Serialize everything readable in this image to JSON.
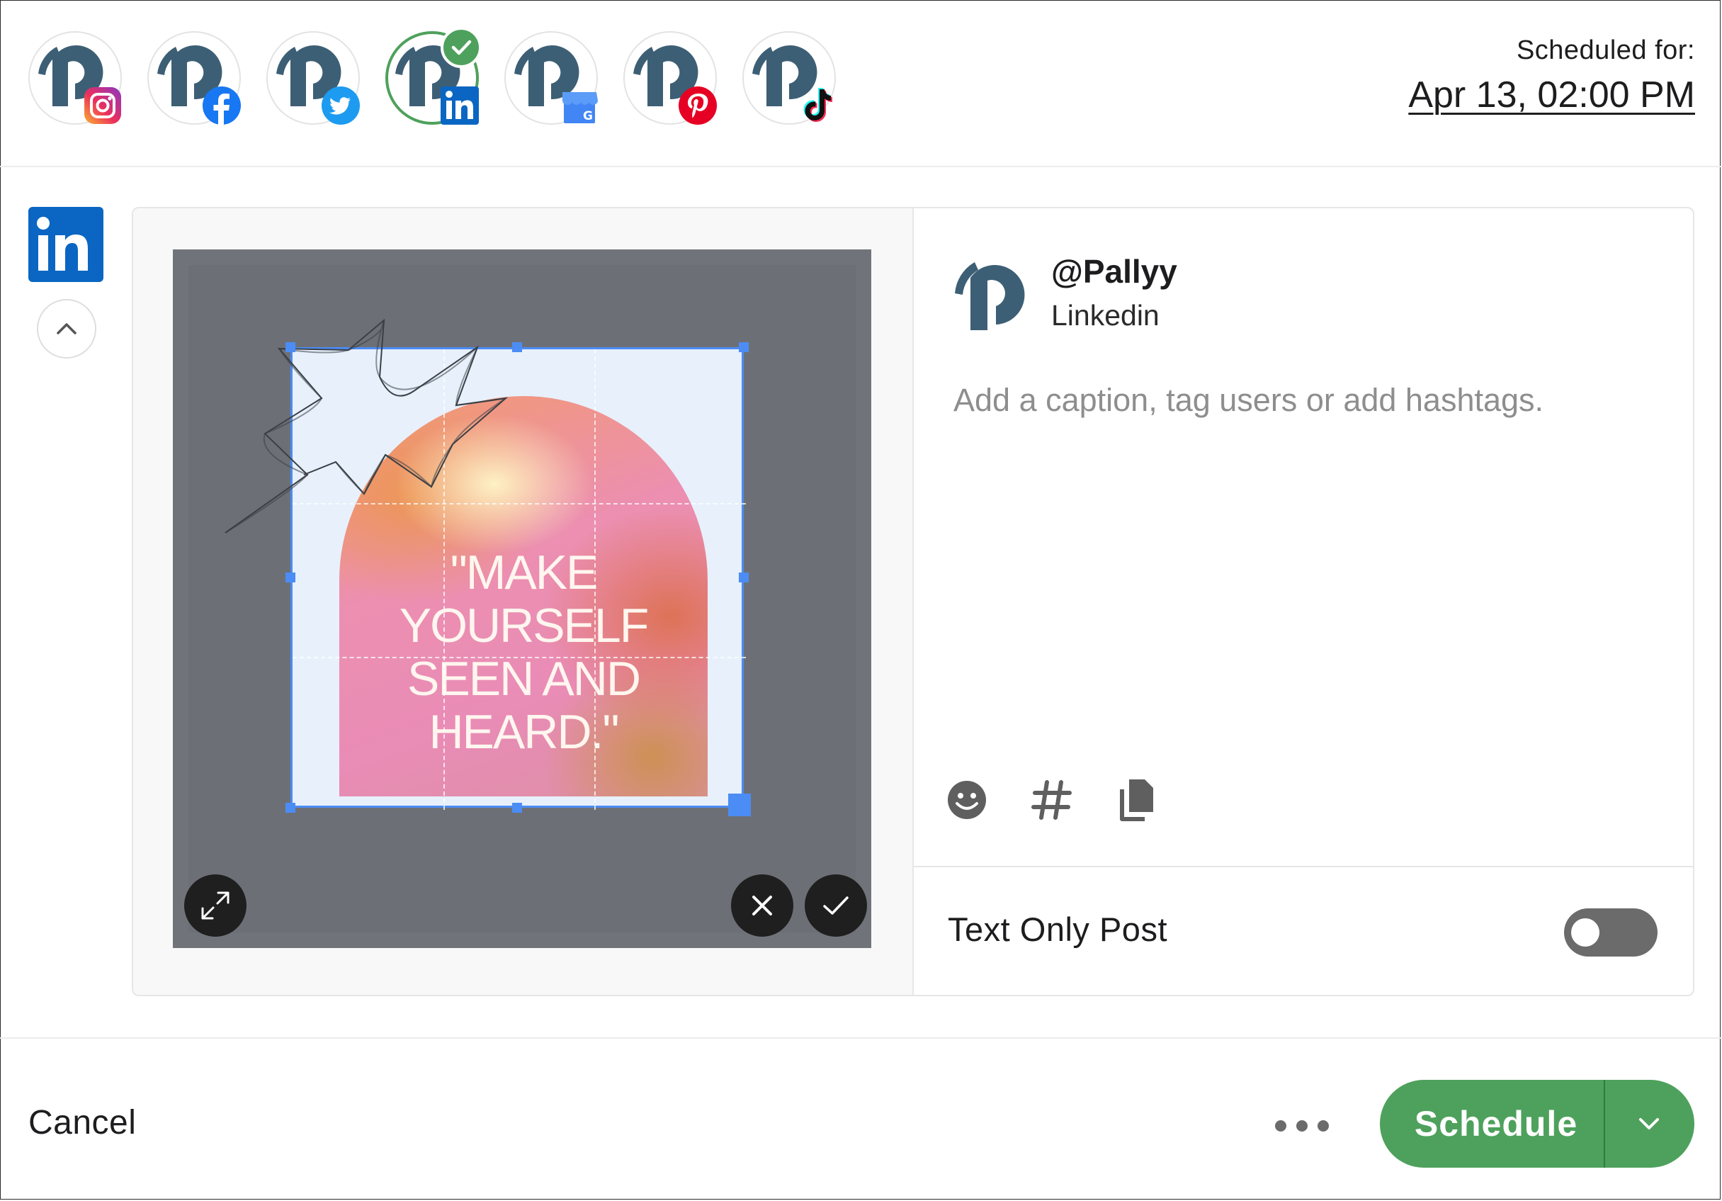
{
  "header": {
    "scheduled_label": "Scheduled for:",
    "scheduled_date": "Apr 13, 02:00 PM",
    "accounts": [
      {
        "network": "instagram",
        "badge_icon": "instagram-icon",
        "selected": false
      },
      {
        "network": "facebook",
        "badge_icon": "facebook-icon",
        "selected": false
      },
      {
        "network": "twitter",
        "badge_icon": "twitter-icon",
        "selected": false
      },
      {
        "network": "linkedin",
        "badge_icon": "linkedin-icon",
        "selected": true
      },
      {
        "network": "google-business",
        "badge_icon": "google-business-icon",
        "selected": false
      },
      {
        "network": "pinterest",
        "badge_icon": "pinterest-icon",
        "selected": false
      },
      {
        "network": "tiktok",
        "badge_icon": "tiktok-icon",
        "selected": false
      }
    ]
  },
  "sidebar": {
    "active_network_icon": "linkedin-icon",
    "collapse_icon": "chevron-up-icon"
  },
  "media": {
    "image_text": [
      "\"MAKE",
      "YOURSELF",
      "SEEN AND",
      "HEARD.\""
    ],
    "expand_icon": "expand-icon",
    "cancel_icon": "close-icon",
    "confirm_icon": "check-icon"
  },
  "post": {
    "handle": "@Pallyy",
    "network": "Linkedin",
    "caption_placeholder": "Add a caption, tag users or add hashtags.",
    "caption_value": "",
    "tools": [
      "emoji-icon",
      "hashtag-icon",
      "copy-icon"
    ],
    "text_only_label": "Text Only Post",
    "text_only_enabled": false
  },
  "footer": {
    "cancel_label": "Cancel",
    "schedule_label": "Schedule",
    "more_icon": "more-horizontal-icon",
    "dropdown_icon": "chevron-down-icon"
  },
  "colors": {
    "accent_green": "#4ea15c",
    "linkedin_blue": "#0a66c2",
    "brand_slate": "#3d5f75",
    "crop_blue": "#4c8cf5"
  }
}
